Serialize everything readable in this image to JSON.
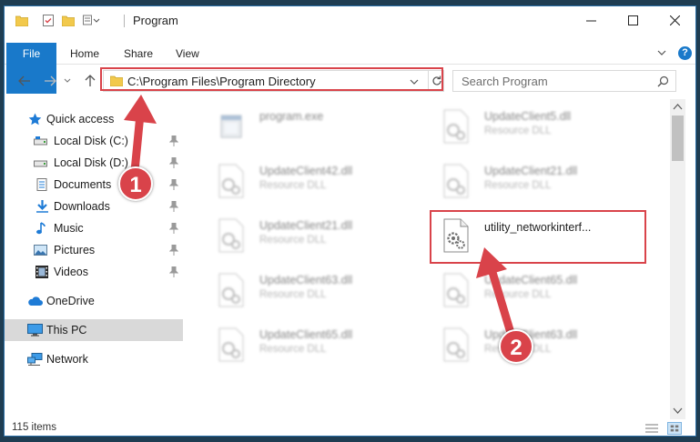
{
  "window": {
    "title": "Program"
  },
  "ribbon": {
    "tabs": [
      {
        "label": "File"
      },
      {
        "label": "Home"
      },
      {
        "label": "Share"
      },
      {
        "label": "View"
      }
    ],
    "help_label": "?"
  },
  "address_bar": {
    "path": "C:\\Program Files\\Program Directory"
  },
  "search": {
    "placeholder": "Search Program"
  },
  "nav_pane": {
    "items": [
      {
        "label": "Quick access",
        "icon": "star-icon"
      },
      {
        "label": "Local Disk (C:)",
        "icon": "drive-icon"
      },
      {
        "label": "Local Disk (D:)",
        "icon": "drive-icon"
      },
      {
        "label": "Documents",
        "icon": "documents-icon"
      },
      {
        "label": "Downloads",
        "icon": "download-icon"
      },
      {
        "label": "Music",
        "icon": "music-icon"
      },
      {
        "label": "Pictures",
        "icon": "pictures-icon"
      },
      {
        "label": "Videos",
        "icon": "videos-icon"
      },
      {
        "label": "OneDrive",
        "icon": "cloud-icon"
      },
      {
        "label": "This PC",
        "icon": "computer-icon"
      },
      {
        "label": "Network",
        "icon": "network-icon"
      }
    ]
  },
  "files": [
    {
      "name": "program.exe",
      "type": ""
    },
    {
      "name": "UpdateClient5.dll",
      "type": "Resource DLL"
    },
    {
      "name": "UpdateClient42.dll",
      "type": "Resource DLL"
    },
    {
      "name": "UpdateClient21.dll",
      "type": "Resource DLL"
    },
    {
      "name": "UpdateClient21.dll",
      "type": "Resource DLL"
    },
    {
      "name": "utility_networkinterf...",
      "type": ""
    },
    {
      "name": "UpdateClient63.dll",
      "type": "Resource DLL"
    },
    {
      "name": "UpdateClient65.dll",
      "type": "Resource DLL"
    },
    {
      "name": "UpdateClient65.dll",
      "type": "Resource DLL"
    },
    {
      "name": "UpdateClient63.dll",
      "type": "Resource DLL"
    }
  ],
  "status": {
    "item_count": "115 items"
  },
  "callouts": {
    "step1": "1",
    "step2": "2"
  },
  "colors": {
    "accent": "#1979ca",
    "annotation": "#d9434a",
    "selection": "#d9d9d9"
  }
}
